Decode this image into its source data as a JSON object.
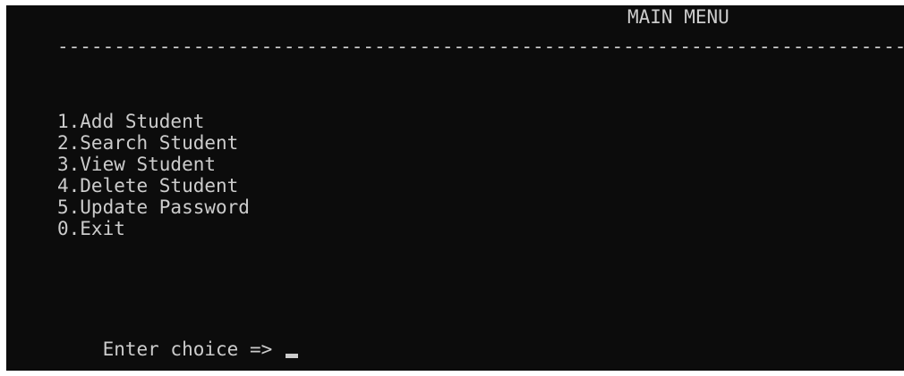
{
  "console": {
    "title": "MAIN MENU",
    "divider": "--------------------------------------------------------------------------------------------------------",
    "menu_items": [
      "1.Add Student",
      "2.Search Student",
      "3.View Student",
      "4.Delete Student",
      "5.Update Password",
      "0.Exit"
    ],
    "prompt": "Enter choice => ",
    "colors": {
      "background": "#0c0c0c",
      "text": "#cccccc"
    }
  }
}
